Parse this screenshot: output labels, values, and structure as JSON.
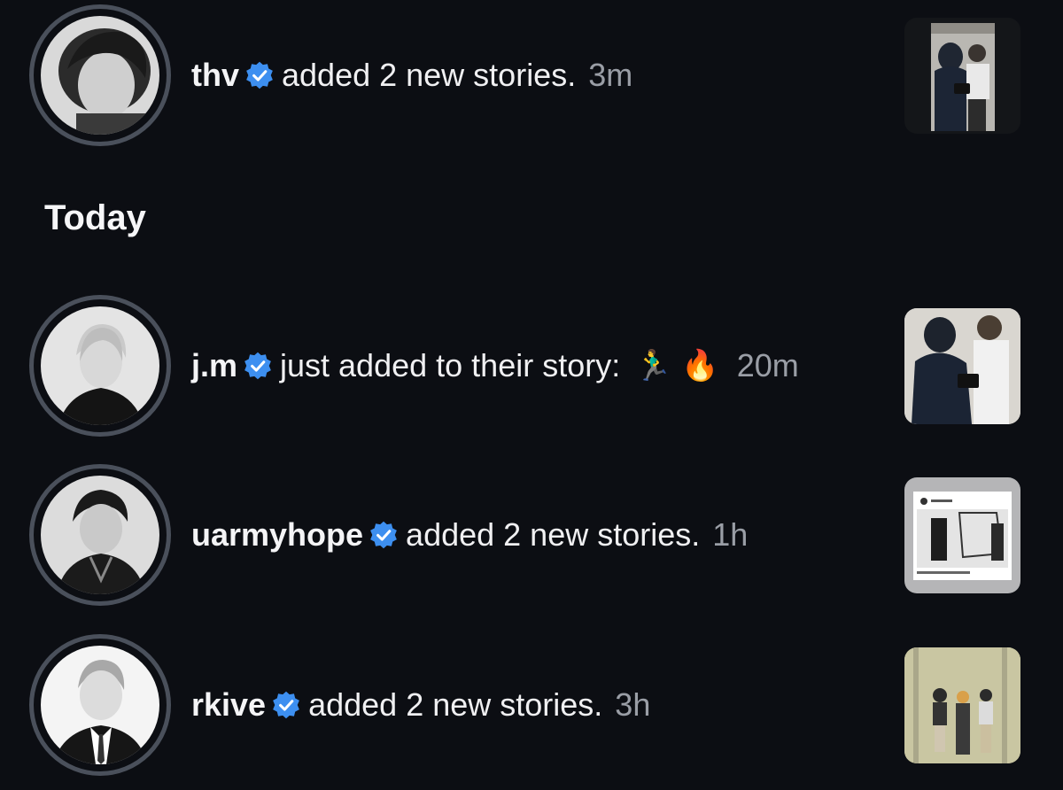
{
  "section_title": "Today",
  "items": [
    {
      "username": "thv",
      "message": "added 2 new stories.",
      "emoji": "",
      "time": "3m",
      "avatar_icon": "profile-photo",
      "thumb_icon": "story-thumbnail"
    },
    {
      "username": "j.m",
      "message": "just added to their story:",
      "emoji": "🏃‍♂️ 🔥",
      "time": "20m",
      "avatar_icon": "profile-photo",
      "thumb_icon": "story-thumbnail"
    },
    {
      "username": "uarmyhope",
      "message": "added 2 new stories.",
      "emoji": "",
      "time": "1h",
      "avatar_icon": "profile-photo",
      "thumb_icon": "story-thumbnail"
    },
    {
      "username": "rkive",
      "message": "added 2 new stories.",
      "emoji": "",
      "time": "3h",
      "avatar_icon": "profile-photo",
      "thumb_icon": "story-thumbnail"
    }
  ],
  "colors": {
    "background": "#0c0e13",
    "ring": "#4a505b",
    "verified": "#3d8ff0",
    "time": "#9a9ea6"
  }
}
